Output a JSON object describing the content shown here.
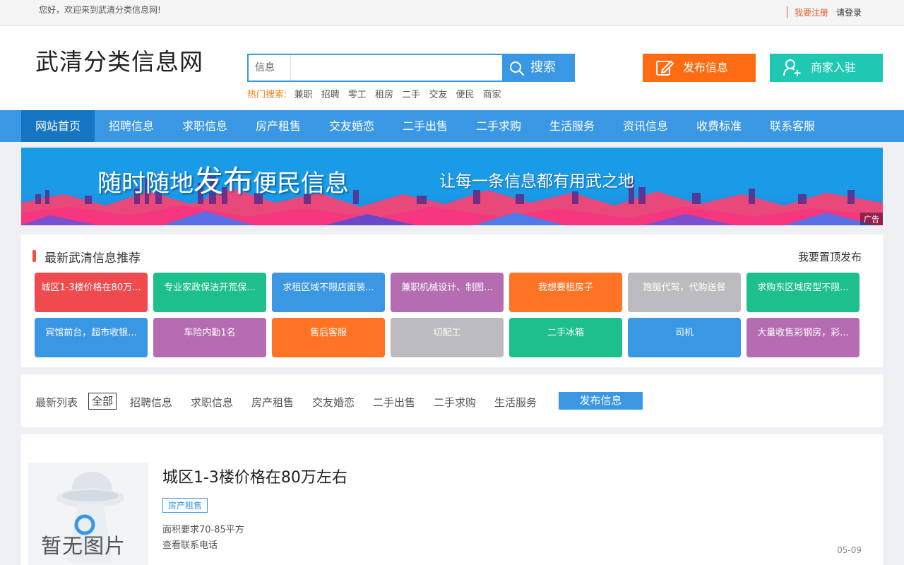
{
  "topbar": {
    "welcome": "您好，欢迎来到武清分类信息网!",
    "register": "我要注册",
    "login": "请登录"
  },
  "header": {
    "logo": "武清分类信息网",
    "search_category": "信息",
    "search_placeholder": "",
    "search_button": "搜索",
    "hot_label": "热门搜索:",
    "hot_terms": [
      "兼职",
      "招聘",
      "零工",
      "租房",
      "二手",
      "交友",
      "便民",
      "商家"
    ],
    "publish_button": "发布信息",
    "merchant_button": "商家入驻"
  },
  "nav": {
    "items": [
      "网站首页",
      "招聘信息",
      "求职信息",
      "房产租售",
      "交友婚恋",
      "二手出售",
      "二手求购",
      "生活服务",
      "资讯信息",
      "收费标准",
      "联系客服"
    ]
  },
  "banner": {
    "slogan_a": "随时随地",
    "slogan_b": "发布",
    "slogan_c": "便民信息",
    "tagline": "让每一条信息都有用武之地",
    "ad_label": "广告"
  },
  "recommend": {
    "title": "最新武清信息推荐",
    "top_publish": "我要置顶发布",
    "tiles": [
      {
        "text": "城区1-3楼价格在80万...",
        "color": "#ef4b4f"
      },
      {
        "text": "专业家政保洁开荒保...",
        "color": "#1dbf8a"
      },
      {
        "text": "求租区域不限店面装...",
        "color": "#3a97e4"
      },
      {
        "text": "兼职机械设计、制图...",
        "color": "#b56cb1"
      },
      {
        "text": "我想要租房子",
        "color": "#ff7324"
      },
      {
        "text": "跑腿代驾，代购送餐",
        "color": "#bcbbc0"
      },
      {
        "text": "求购东区域房型不限...",
        "color": "#1dbf8a"
      },
      {
        "text": "宾馆前台，超市收银...",
        "color": "#3a97e4"
      },
      {
        "text": "车险内勤1名",
        "color": "#b56cb1"
      },
      {
        "text": "售后客服",
        "color": "#ff7324"
      },
      {
        "text": "切配工",
        "color": "#bcbbc0"
      },
      {
        "text": "二手冰箱",
        "color": "#1dbf8a"
      },
      {
        "text": "司机",
        "color": "#3a97e4"
      },
      {
        "text": "大量收售彩钢房，彩...",
        "color": "#b56cb1"
      }
    ]
  },
  "filters": {
    "label": "最新列表",
    "items": [
      "全部",
      "招聘信息",
      "求职信息",
      "房产租售",
      "交友婚恋",
      "二手出售",
      "二手求购",
      "生活服务"
    ],
    "active": "全部",
    "publish_button": "发布信息"
  },
  "listing": {
    "no_image_text": "暂无图片",
    "title": "城区1-3楼价格在80万左右",
    "tag": "房产租售",
    "desc": "面积要求70-85平方",
    "phone_link": "查看联系电话",
    "date": "05-09"
  },
  "colors": {
    "primary": "#3a97e4",
    "nav_active": "#1676c4",
    "publish": "#ff6b13",
    "merchant": "#1ec8b2",
    "accent_red": "#f0504a"
  }
}
